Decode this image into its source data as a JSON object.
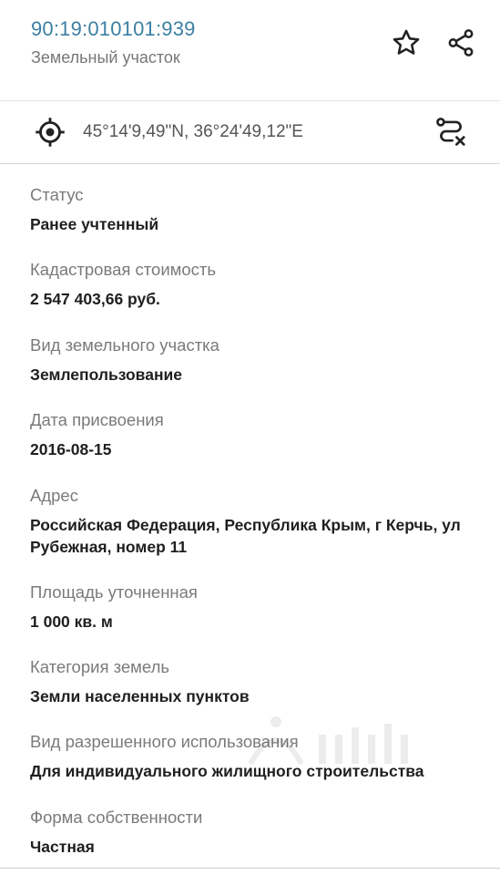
{
  "header": {
    "cadastral_number": "90:19:010101:939",
    "object_type": "Земельный участок",
    "star_icon": "star-outline-icon",
    "share_icon": "share-icon"
  },
  "coordinates": {
    "icon": "crosshair-target-icon",
    "text": "45°14'9,49\"N, 36°24'49,12\"E",
    "route_icon": "route-clear-icon"
  },
  "fields": [
    {
      "label": "Статус",
      "value": "Ранее учтенный"
    },
    {
      "label": "Кадастровая стоимость",
      "value": "2 547 403,66 руб."
    },
    {
      "label": "Вид земельного участка",
      "value": "Землепользование"
    },
    {
      "label": "Дата присвоения",
      "value": "2016-08-15"
    },
    {
      "label": "Адрес",
      "value": "Российская Федерация, Республика Крым, г Керчь, ул Рубежная, номер 11"
    },
    {
      "label": "Площадь уточненная",
      "value": "1 000 кв. м"
    },
    {
      "label": "Категория земель",
      "value": "Земли населенных пунктов"
    },
    {
      "label": "Вид разрешенного использования",
      "value": "Для индивидуального жилищного строительства"
    },
    {
      "label": "Форма собственности",
      "value": "Частная"
    }
  ],
  "colors": {
    "accent": "#3b7fa3",
    "label": "#7a7a7a",
    "value": "#1f1f1f"
  }
}
